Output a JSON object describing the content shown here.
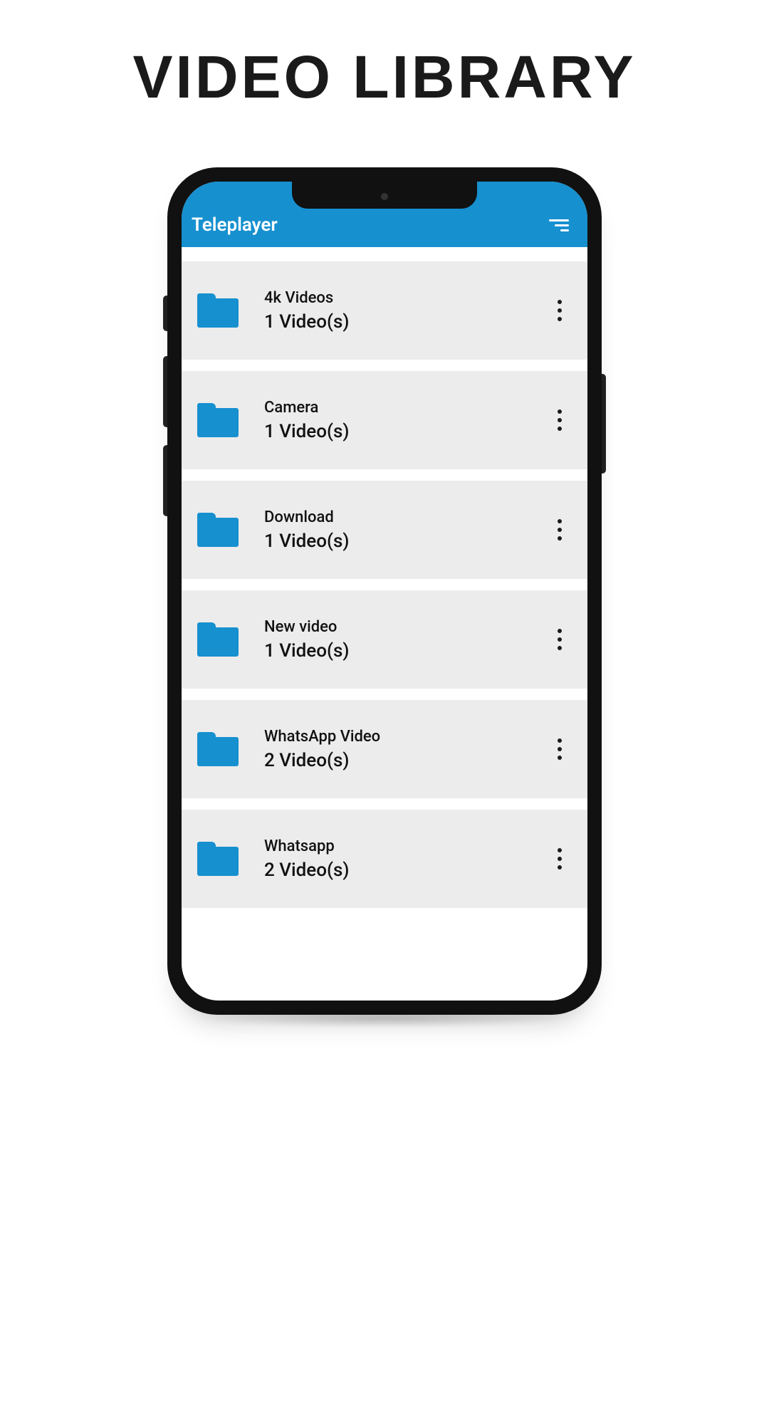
{
  "page": {
    "title": "VIDEO LIBRARY"
  },
  "app": {
    "title": "Teleplayer"
  },
  "colors": {
    "accent": "#1690cf",
    "row_bg": "#ececec"
  },
  "folders": [
    {
      "name": "4k Videos",
      "count_label": "1 Video(s)"
    },
    {
      "name": "Camera",
      "count_label": "1 Video(s)"
    },
    {
      "name": "Download",
      "count_label": "1 Video(s)"
    },
    {
      "name": "New video",
      "count_label": "1 Video(s)"
    },
    {
      "name": "WhatsApp Video",
      "count_label": "2 Video(s)"
    },
    {
      "name": "Whatsapp",
      "count_label": "2 Video(s)"
    }
  ]
}
